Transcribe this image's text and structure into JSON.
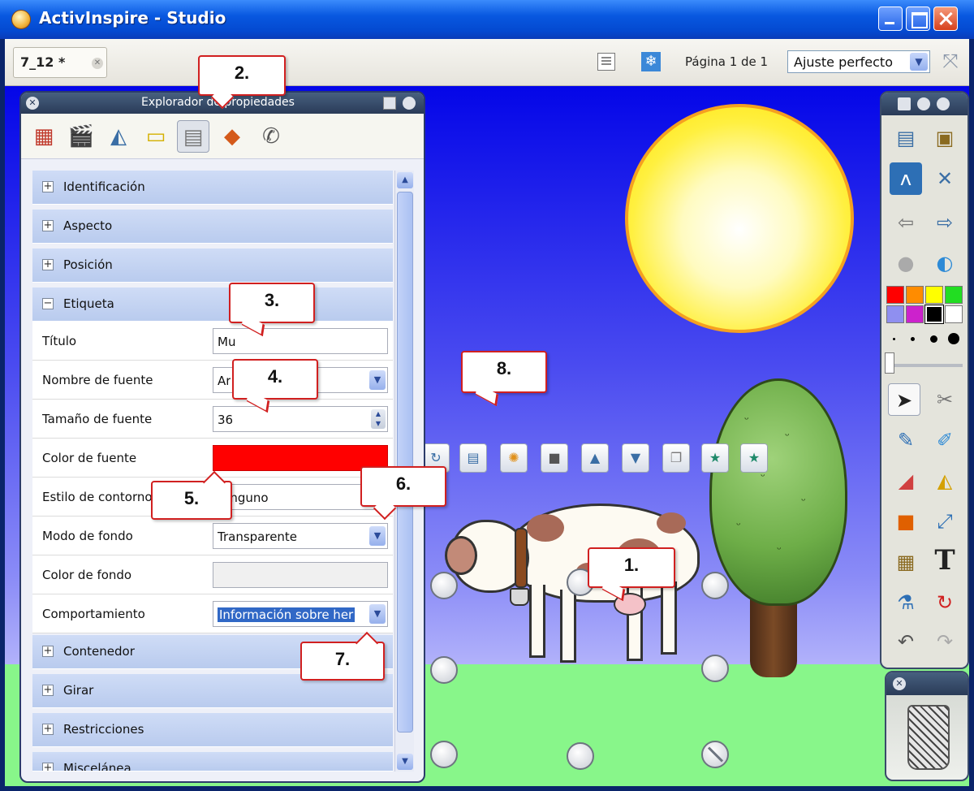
{
  "window": {
    "title": "ActivInspire - Studio"
  },
  "tabbar": {
    "doc_tab": "7_12 *",
    "page_info": "Página 1 de 1",
    "zoom": "Ajuste perfecto"
  },
  "props_panel": {
    "title": "Explorador de propiedades",
    "sections_before": [
      "Identificación",
      "Aspecto",
      "Posición"
    ],
    "expanded_section": "Etiqueta",
    "rows": [
      {
        "label": "Título",
        "value": "Mu",
        "type": "text"
      },
      {
        "label": "Nombre de fuente",
        "value": "Ar",
        "type": "select"
      },
      {
        "label": "Tamaño de fuente",
        "value": "36",
        "type": "spin"
      },
      {
        "label": "Color de fuente",
        "value": "",
        "type": "color",
        "color": "#ff0000"
      },
      {
        "label": "Estilo de contorno",
        "value": "Ninguno",
        "type": "select"
      },
      {
        "label": "Modo de fondo",
        "value": "Transparente",
        "type": "select"
      },
      {
        "label": "Color de fondo",
        "value": "",
        "type": "color",
        "color": "#f0f0f0"
      },
      {
        "label": "Comportamiento",
        "value": "Información sobre her",
        "type": "select-highlighted"
      }
    ],
    "sections_after": [
      "Contenedor",
      "Girar",
      "Restricciones",
      "Miscelánea"
    ]
  },
  "callouts": [
    "1.",
    "2.",
    "3.",
    "4.",
    "5.",
    "6.",
    "7.",
    "8."
  ],
  "colors": {
    "palette": [
      "#ff0000",
      "#ff8c00",
      "#ffff00",
      "#22dd22",
      "#8f8ff0",
      "#cc22cc",
      "#000000",
      "#ffffff"
    ],
    "accent_callout": "#d12020"
  }
}
